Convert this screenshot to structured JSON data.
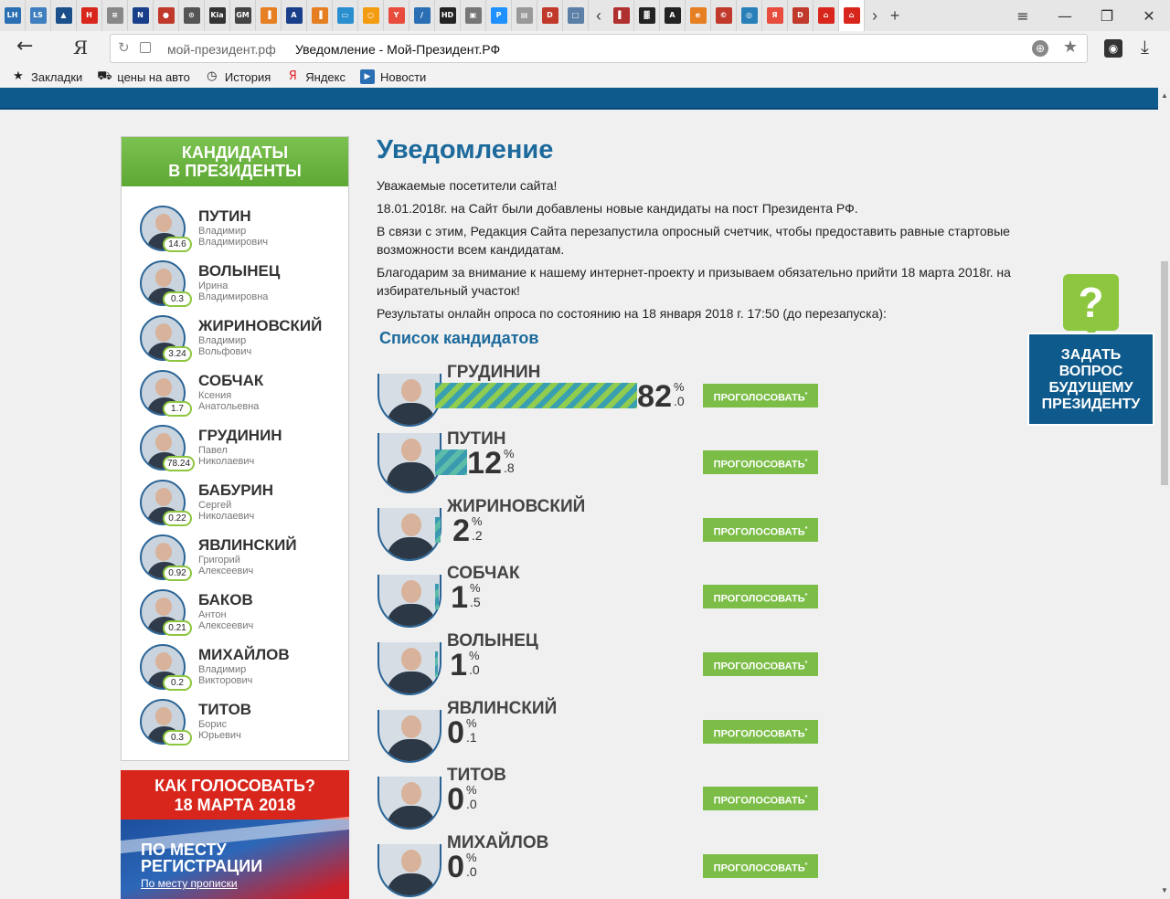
{
  "browser": {
    "tab_favicons": [
      {
        "icon": "LH",
        "color": "#2a6fb3"
      },
      {
        "icon": "LS",
        "color": "#3f7fbf"
      },
      {
        "icon": "▲",
        "color": "#1a4f8a"
      },
      {
        "icon": "H",
        "color": "#d9261c"
      },
      {
        "icon": "≡",
        "color": "#888888"
      },
      {
        "icon": "N",
        "color": "#1a3f8a"
      },
      {
        "icon": "●",
        "color": "#c0392b"
      },
      {
        "icon": "⊙",
        "color": "#555555"
      },
      {
        "icon": "Kia",
        "color": "#333333"
      },
      {
        "icon": "GM",
        "color": "#444444"
      },
      {
        "icon": "▐",
        "color": "#e67e22"
      },
      {
        "icon": "A",
        "color": "#1a3f8a"
      },
      {
        "icon": "▐",
        "color": "#e67e22"
      },
      {
        "icon": "▭",
        "color": "#2a8fcf"
      },
      {
        "icon": "○",
        "color": "#f39c12"
      },
      {
        "icon": "Y",
        "color": "#e74c3c"
      },
      {
        "icon": "∕",
        "color": "#2a6fb3"
      },
      {
        "icon": "HD",
        "color": "#222222"
      },
      {
        "icon": "▣",
        "color": "#777777"
      },
      {
        "icon": "P",
        "color": "#1e90ff"
      },
      {
        "icon": "▤",
        "color": "#999999"
      },
      {
        "icon": "D",
        "color": "#c0392b"
      },
      {
        "icon": "□",
        "color": "#5b7fa6"
      }
    ],
    "tab_favicons_right": [
      {
        "icon": "▌",
        "color": "#b03030"
      },
      {
        "icon": "▓",
        "color": "#222222"
      },
      {
        "icon": "A",
        "color": "#222222"
      },
      {
        "icon": "e",
        "color": "#e67e22"
      },
      {
        "icon": "©",
        "color": "#c0392b"
      },
      {
        "icon": "◎",
        "color": "#2980b9"
      },
      {
        "icon": "Я",
        "color": "#e74c3c"
      },
      {
        "icon": "D",
        "color": "#c0392b"
      },
      {
        "icon": "⌂",
        "color": "#d9261c"
      },
      {
        "icon": "⌂",
        "color": "#d9261c"
      }
    ],
    "url_domain": "мой-президент.рф",
    "url_title": "Уведомление - Мой-Президент.РФ",
    "bookmarks": [
      {
        "icon": "star-icon",
        "glyph": "★",
        "label": "Закладки"
      },
      {
        "icon": "car-icon",
        "glyph": "⛟",
        "label": "цены на авто"
      },
      {
        "icon": "clock-icon",
        "glyph": "◷",
        "label": "История"
      },
      {
        "icon": "yandex-icon",
        "glyph": "Я",
        "label": "Яндекс"
      },
      {
        "icon": "news-icon",
        "glyph": "▶",
        "label": "Новости"
      }
    ]
  },
  "sidebar": {
    "title_line1": "КАНДИДАТЫ",
    "title_line2": "В ПРЕЗИДЕНТЫ",
    "candidates": [
      {
        "last": "ПУТИН",
        "first": "Владимир",
        "patronymic": "Владимирович",
        "score": "14.6"
      },
      {
        "last": "ВОЛЫНЕЦ",
        "first": "Ирина",
        "patronymic": "Владимировна",
        "score": "0.3"
      },
      {
        "last": "ЖИРИНОВСКИЙ",
        "first": "Владимир",
        "patronymic": "Вольфович",
        "score": "3.24"
      },
      {
        "last": "СОБЧАК",
        "first": "Ксения",
        "patronymic": "Анатольевна",
        "score": "1.7"
      },
      {
        "last": "ГРУДИНИН",
        "first": "Павел",
        "patronymic": "Николаевич",
        "score": "78.24"
      },
      {
        "last": "БАБУРИН",
        "first": "Сергей",
        "patronymic": "Николаевич",
        "score": "0.22"
      },
      {
        "last": "ЯВЛИНСКИЙ",
        "first": "Григорий",
        "patronymic": "Алексеевич",
        "score": "0.92"
      },
      {
        "last": "БАКОВ",
        "first": "Антон",
        "patronymic": "Алексеевич",
        "score": "0.21"
      },
      {
        "last": "МИХАЙЛОВ",
        "first": "Владимир",
        "patronymic": "Викторович",
        "score": "0.2"
      },
      {
        "last": "ТИТОВ",
        "first": "Борис",
        "patronymic": "Юрьевич",
        "score": "0.3"
      }
    ]
  },
  "how_to_vote": {
    "title_line1": "КАК ГОЛОСОВАТЬ?",
    "title_line2": "18 МАРТА 2018",
    "image_title": "ПО МЕСТУ РЕГИСТРАЦИИ",
    "link": "По месту прописки"
  },
  "main": {
    "title": "Уведомление",
    "paragraphs": [
      "Уважаемые посетители сайта!",
      "18.01.2018г. на Сайт были добавлены новые кандидаты на пост Президента РФ.",
      "В связи с этим, Редакция Сайта перезапустила опросный счетчик, чтобы предоставить равные стартовые возможности всем кандидатам.",
      "Благодарим за внимание к нашему интернет-проекту и призываем обязательно прийти 18 марта 2018г. на избирательный участок!",
      "Результаты онлайн опроса по состоянию на 18 января 2018 г. 17:50 (до перезапуска):"
    ],
    "list_title": "Список кандидатов",
    "vote_label": "ПРОГОЛОСОВАТЬ",
    "vote_mark": "*",
    "percent_sign": "%",
    "results": [
      {
        "name": "ГРУДИНИН",
        "int": "82",
        "dec": ".0",
        "percent": 82.0
      },
      {
        "name": "ПУТИН",
        "int": "12",
        "dec": ".8",
        "percent": 12.8
      },
      {
        "name": "ЖИРИНОВСКИЙ",
        "int": "2",
        "dec": ".2",
        "percent": 2.2
      },
      {
        "name": "СОБЧАК",
        "int": "1",
        "dec": ".5",
        "percent": 1.5
      },
      {
        "name": "ВОЛЫНЕЦ",
        "int": "1",
        "dec": ".0",
        "percent": 1.0
      },
      {
        "name": "ЯВЛИНСКИЙ",
        "int": "0",
        "dec": ".1",
        "percent": 0.1
      },
      {
        "name": "ТИТОВ",
        "int": "0",
        "dec": ".0",
        "percent": 0.0
      },
      {
        "name": "МИХАЙЛОВ",
        "int": "0",
        "dec": ".0",
        "percent": 0.0
      }
    ]
  },
  "ask_widget": {
    "glyph": "?",
    "text": "ЗАДАТЬ ВОПРОС БУДУЩЕМУ ПРЕЗИДЕНТУ"
  }
}
